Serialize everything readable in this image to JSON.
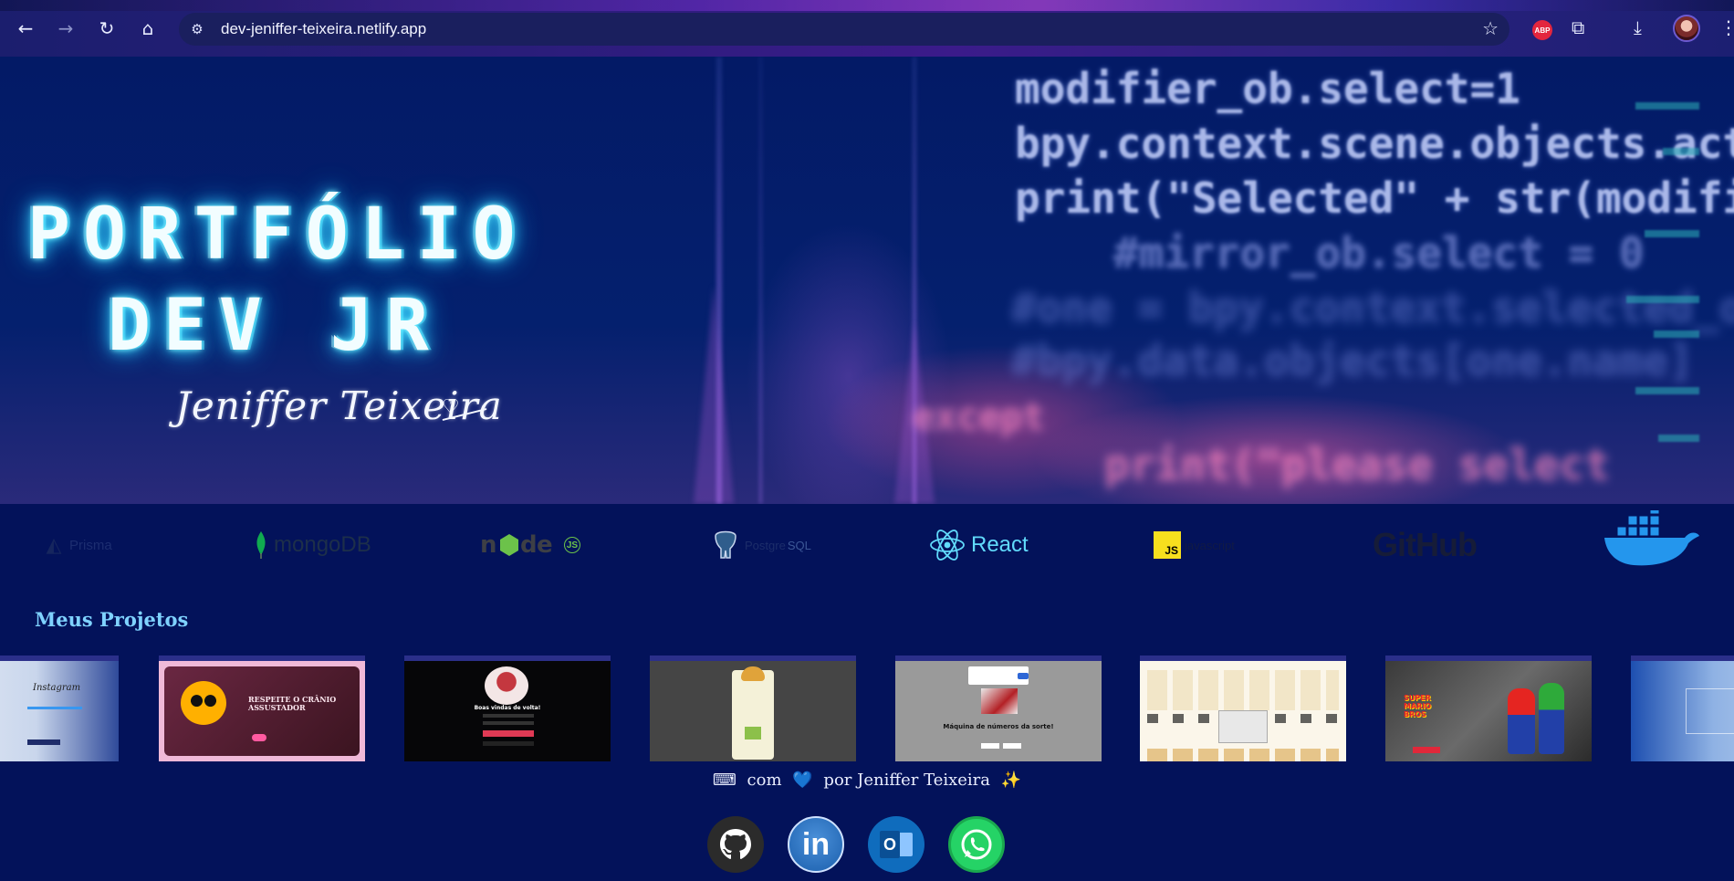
{
  "browser": {
    "url": "dev-jeniffer-teixeira.netlify.app",
    "extension_badge": "ABP"
  },
  "hero": {
    "title_line1": "PORTFÓLIO",
    "title_line2": "DEV  JR",
    "signature": "Jeniffer Teixeira",
    "code_lines": [
      "modifier_ob.select=1",
      "bpy.context.scene.objects.act",
      "print(\"Selected\" + str(modifi",
      "#mirror_ob.select = 0",
      "#one = bpy.context.selected_o",
      "#bpy.data.objects[one.name]",
      "except",
      "print(\"please select"
    ]
  },
  "tech_stack": [
    {
      "name": "Prisma",
      "icon": "prisma-icon"
    },
    {
      "name": "mongoDB",
      "icon": "mongodb-leaf-icon"
    },
    {
      "name": "node",
      "icon": "nodejs-icon",
      "suffix": "JS"
    },
    {
      "name": "SQL",
      "prefix": "Postgre",
      "icon": "postgresql-elephant-icon"
    },
    {
      "name": "React",
      "icon": "react-atom-icon"
    },
    {
      "name": "javascript",
      "badge": "JS",
      "icon": "javascript-icon"
    },
    {
      "name": "GitHub",
      "icon": "github-wordmark-icon"
    },
    {
      "name": "Docker",
      "icon": "docker-whale-icon"
    }
  ],
  "projects": {
    "title": "Meus Projetos",
    "items": [
      {
        "id": "instagram",
        "label": "Instagram"
      },
      {
        "id": "skull",
        "label": "RESPEITE O CRÂNIO ASSUSTADOR"
      },
      {
        "id": "welcome",
        "label": "Boas vindas de volta!"
      },
      {
        "id": "burger",
        "label": ""
      },
      {
        "id": "lottery",
        "label": "Máquina de números da sorte!"
      },
      {
        "id": "memory",
        "label": ""
      },
      {
        "id": "mario",
        "label": "SUPER MARIO BROS"
      },
      {
        "id": "blue",
        "label": ""
      }
    ]
  },
  "footer": {
    "keyboard": "⌨",
    "word_com": "com",
    "heart": "💙",
    "by": "por Jeniffer Teixeira",
    "sparkle": "✨",
    "socials": [
      {
        "name": "github",
        "label": "GitHub"
      },
      {
        "name": "linkedin",
        "label": "in"
      },
      {
        "name": "outlook",
        "label": "O"
      },
      {
        "name": "whatsapp",
        "label": "WhatsApp"
      }
    ]
  },
  "colors": {
    "background": "#03125a",
    "accent_cyan": "#7fd2ff",
    "neon_glow": "#3ed9ff"
  }
}
